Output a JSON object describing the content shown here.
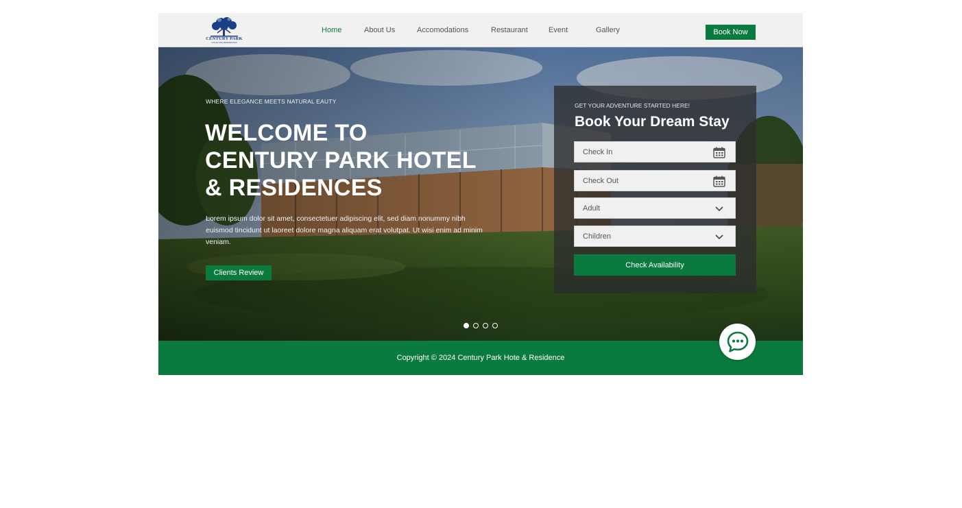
{
  "brand": {
    "name": "CENTURY PARK",
    "tagline": "HOTEL AND RESIDENCES",
    "color": "#1b3f86"
  },
  "nav": {
    "items": [
      {
        "label": "Home",
        "active": true
      },
      {
        "label": "About Us",
        "active": false
      },
      {
        "label": "Accomodations",
        "active": false
      },
      {
        "label": "Restaurant",
        "active": false
      },
      {
        "label": "Event",
        "active": false
      },
      {
        "label": "Gallery",
        "active": false
      }
    ],
    "cta": "Book Now"
  },
  "hero": {
    "eyebrow": "WHERE ELEGANCE MEETS NATURAL EAUTY",
    "headline_line1": "WELCOME TO",
    "headline_line2": "CENTURY PARK HOTEL",
    "headline_line3": "& RESIDENCES",
    "lede": "Lorem ipsum dolor sit amet, consectetuer adipiscing elit, sed diam nonummy nibh euismod tincidunt ut laoreet dolore magna aliquam erat volutpat. Ut wisi enim ad minim veniam.",
    "cta": "Clients Review",
    "slides": {
      "count": 4,
      "active_index": 0
    }
  },
  "booking": {
    "eyebrow": "GET YOUR ADVENTURE STARTED HERE!",
    "title": "Book Your Dream Stay",
    "check_in": {
      "placeholder": "Check In",
      "icon": "calendar-icon"
    },
    "check_out": {
      "placeholder": "Check Out",
      "icon": "calendar-icon"
    },
    "adult": {
      "value": "Adult",
      "icon": "chevron-down-icon"
    },
    "children": {
      "value": "Children",
      "icon": "chevron-down-icon"
    },
    "submit": "Check Availability"
  },
  "footer": {
    "copyright": "Copyright © 2024 Century Park Hote & Residence"
  },
  "chat": {
    "icon": "chat-bubble-icon"
  },
  "colors": {
    "accent": "#0b7a3e",
    "nav_bg": "#f1f1f1",
    "panel_bg": "rgba(45,45,45,0.78)"
  }
}
